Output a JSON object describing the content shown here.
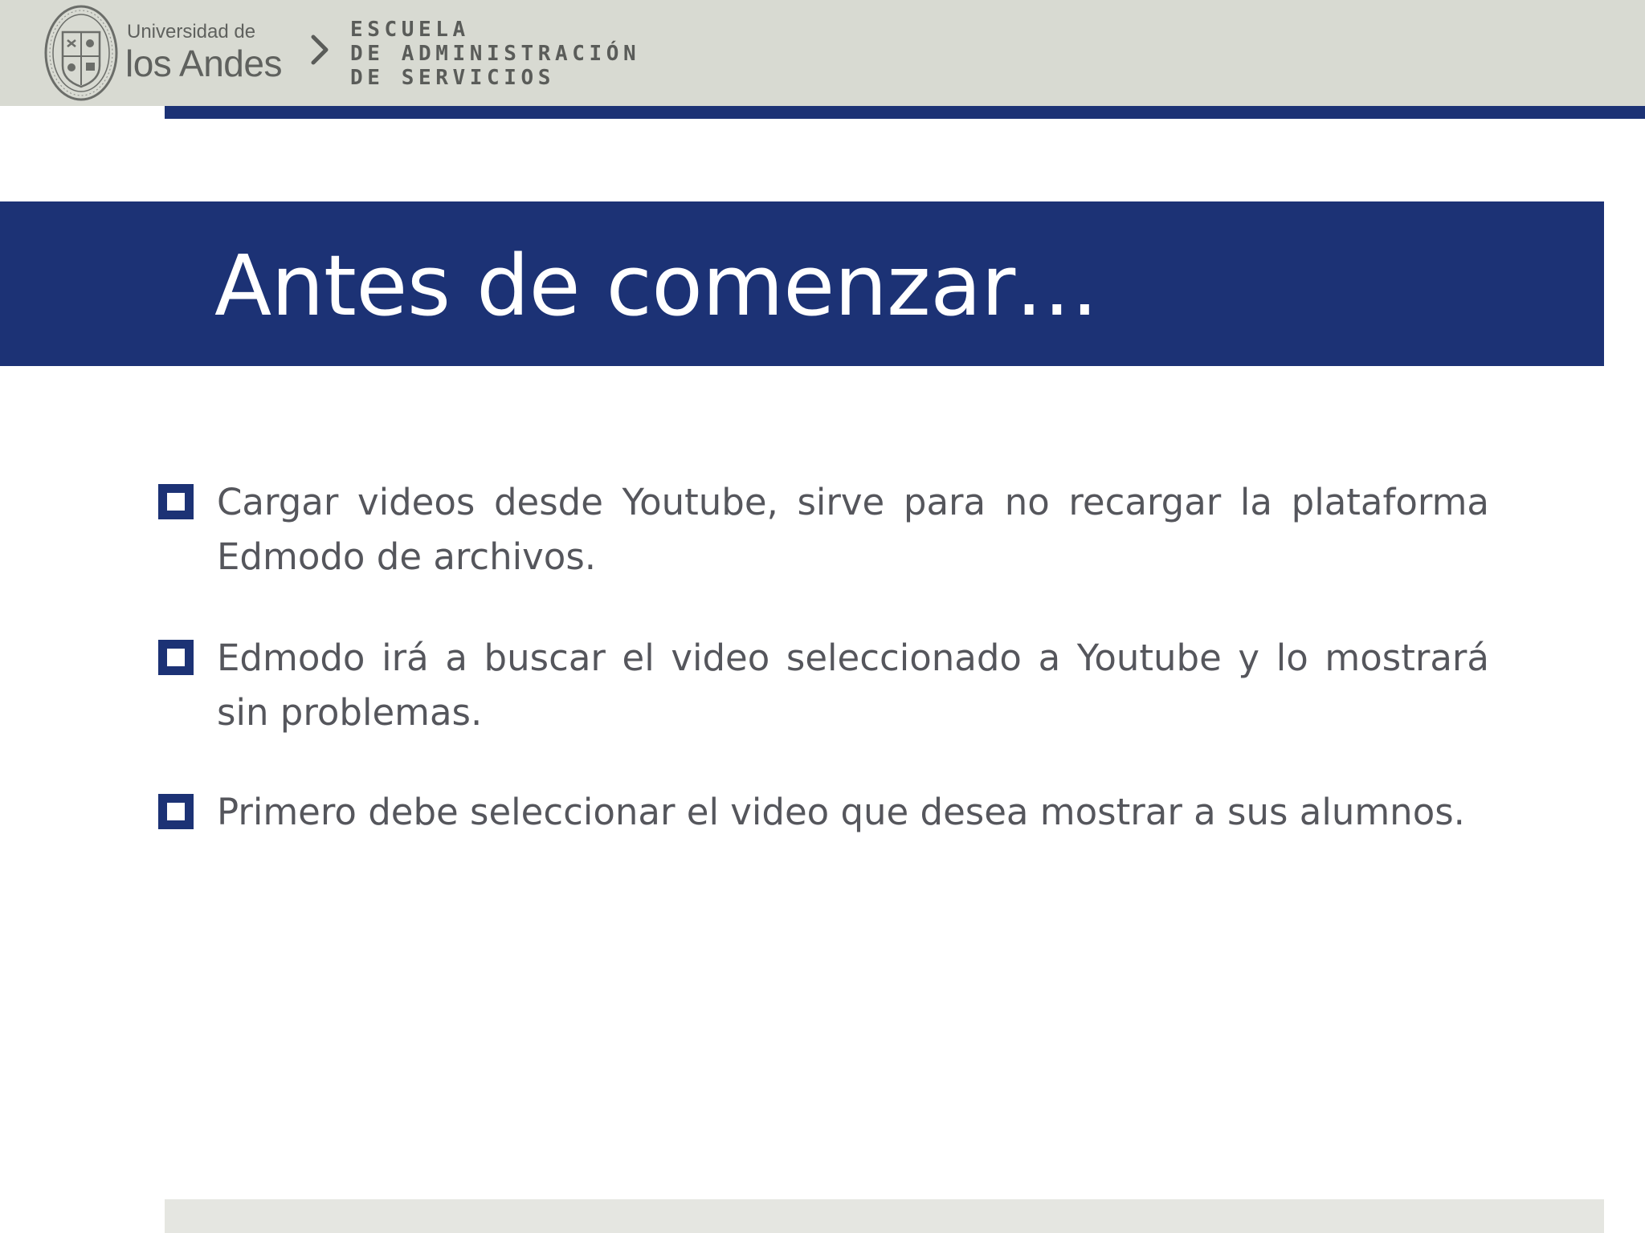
{
  "header": {
    "university_small": "Universidad de",
    "university_big": "los Andes",
    "school_lines": [
      "ESCUELA",
      "DE ADMINISTRACIÓN",
      "DE SERVICIOS"
    ],
    "seal_icon": "university-seal-icon",
    "separator_icon": "chevron-right-icon"
  },
  "slide": {
    "title": "Antes de comenzar…",
    "bullets": [
      "Cargar videos desde Youtube, sirve para no recargar la plataforma Edmodo de archivos.",
      "Edmodo irá a buscar el video seleccionado a Youtube y lo mostrará sin problemas.",
      "Primero debe seleccionar el video que desea mostrar a sus alumnos."
    ],
    "bullet_icon": "square-bullet-icon"
  },
  "colors": {
    "brand_navy": "#1c3275",
    "header_gray": "#d8dad2",
    "body_text": "#55565c",
    "footer_gray": "#e5e6e1"
  }
}
